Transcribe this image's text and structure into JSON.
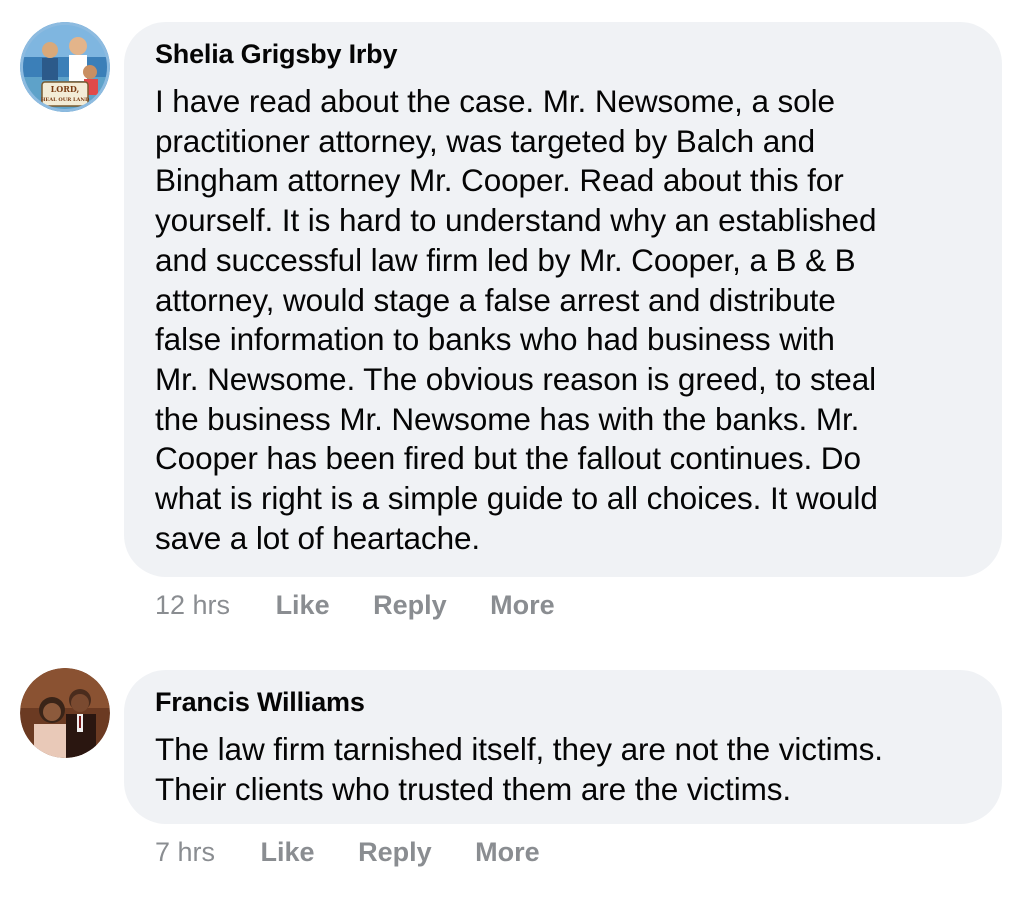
{
  "comments": [
    {
      "author": "Shelia Grigsby Irby",
      "avatar_icon": "profile-photo-icon",
      "avatar_text_line1": "LORD,",
      "avatar_text_line2": "HEAL OUR LAND",
      "text": "I have read about the case. Mr. Newsome, a sole\npractitioner attorney, was targeted by Balch and\nBingham attorney Mr. Cooper. Read about this for\nyourself. It is hard to understand why an established\nand successful law firm led by Mr. Cooper, a B & B\nattorney, would stage a false arrest and distribute\nfalse information to banks who had business with\nMr. Newsome. The obvious reason is greed, to steal\nthe business Mr. Newsome has with the banks. Mr.\nCooper has been fired but the fallout continues. Do\nwhat is right is a simple guide to all choices. It would\nsave a lot of heartache.",
      "time": "12 hrs",
      "like": "Like",
      "reply": "Reply",
      "more": "More"
    },
    {
      "author": "Francis Williams",
      "avatar_icon": "profile-photo-icon",
      "text": "The law firm tarnished itself, they are not the victims.\nTheir clients who trusted them are the victims.",
      "time": "7 hrs",
      "like": "Like",
      "reply": "Reply",
      "more": "More"
    }
  ],
  "colors": {
    "bubble_bg": "#f0f2f5",
    "text": "#050505",
    "muted": "#8a8d91"
  }
}
